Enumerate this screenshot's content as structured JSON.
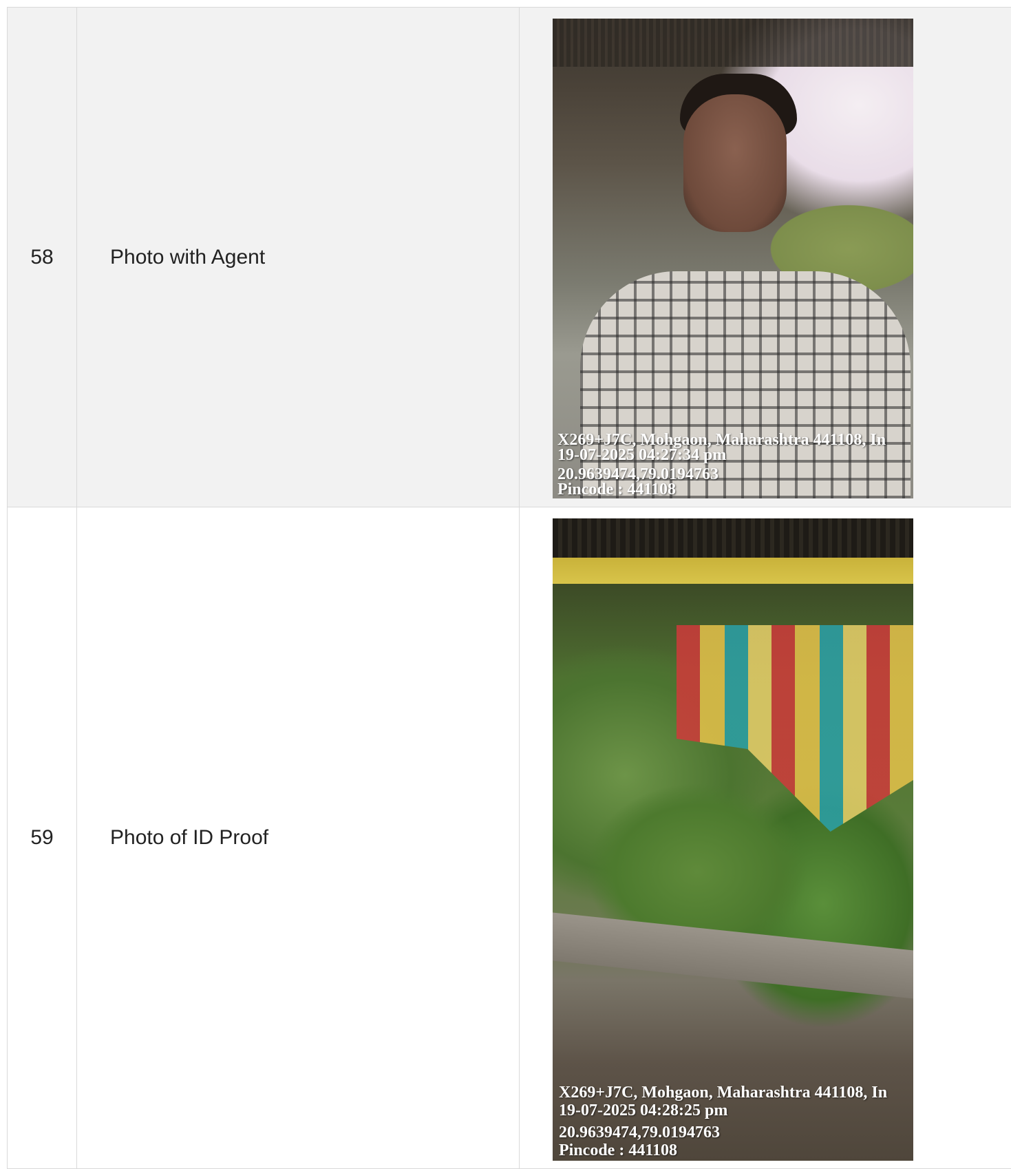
{
  "rows": [
    {
      "number": "58",
      "label": "Photo with Agent",
      "photo": {
        "address": "X269+J7C, Mohgaon, Maharashtra 441108, In",
        "timestamp": "19-07-2025 04:27:34 pm",
        "coordinates": "20.9639474,79.0194763",
        "pincode": "Pincode : 441108"
      }
    },
    {
      "number": "59",
      "label": "Photo of ID Proof",
      "photo": {
        "address": "X269+J7C, Mohgaon, Maharashtra 441108, In",
        "timestamp": "19-07-2025 04:28:25 pm",
        "coordinates": "20.9639474,79.0194763",
        "pincode": "Pincode : 441108"
      }
    }
  ]
}
